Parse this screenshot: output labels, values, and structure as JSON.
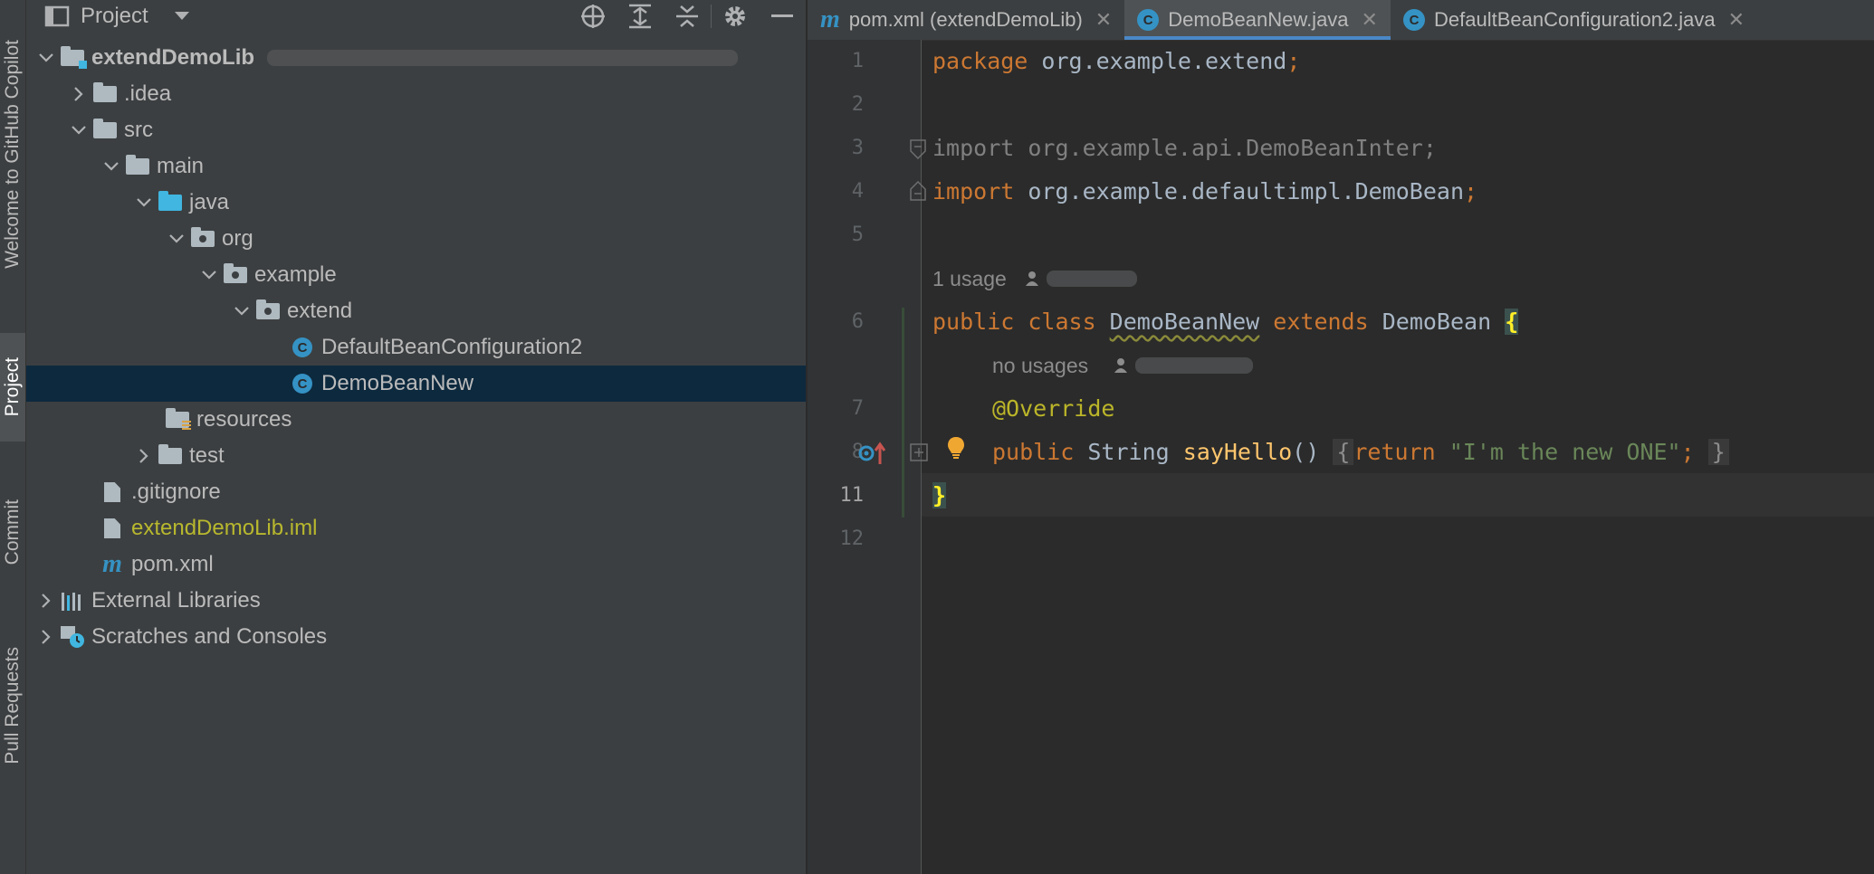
{
  "sidebar_tabs": [
    {
      "label": "Welcome to GitHub Copilot"
    },
    {
      "label": "Project"
    },
    {
      "label": "Commit"
    },
    {
      "label": "Pull Requests"
    }
  ],
  "project_panel": {
    "title": "Project",
    "tools": [
      "locate-icon",
      "expand-all-icon",
      "collapse-all-icon",
      "gear-icon",
      "minimize-icon"
    ],
    "tree": [
      {
        "label": "extendDemoLib",
        "depth": 0,
        "expanded": true,
        "icon": "module-folder-icon",
        "bold": true
      },
      {
        "label": ".idea",
        "depth": 1,
        "expanded": false,
        "icon": "folder-icon"
      },
      {
        "label": "src",
        "depth": 1,
        "expanded": true,
        "icon": "folder-icon"
      },
      {
        "label": "main",
        "depth": 2,
        "expanded": true,
        "icon": "folder-icon"
      },
      {
        "label": "java",
        "depth": 3,
        "expanded": true,
        "icon": "source-folder-icon"
      },
      {
        "label": "org",
        "depth": 4,
        "expanded": true,
        "icon": "package-icon"
      },
      {
        "label": "example",
        "depth": 5,
        "expanded": true,
        "icon": "package-icon"
      },
      {
        "label": "extend",
        "depth": 6,
        "expanded": true,
        "icon": "package-icon"
      },
      {
        "label": "DefaultBeanConfiguration2",
        "depth": 7,
        "icon": "class-icon"
      },
      {
        "label": "DemoBeanNew",
        "depth": 7,
        "icon": "class-icon",
        "selected": true
      },
      {
        "label": "resources",
        "depth": 4,
        "icon": "resources-folder-icon"
      },
      {
        "label": "test",
        "depth": 3,
        "expanded": false,
        "icon": "folder-icon"
      },
      {
        "label": ".gitignore",
        "depth": 2,
        "icon": "file-icon"
      },
      {
        "label": "extendDemoLib.iml",
        "depth": 2,
        "icon": "file-icon",
        "color": "#b8b82e"
      },
      {
        "label": "pom.xml",
        "depth": 2,
        "icon": "maven-icon"
      },
      {
        "label": "External Libraries",
        "depth": 0,
        "expanded": false,
        "icon": "libraries-icon"
      },
      {
        "label": "Scratches and Consoles",
        "depth": 0,
        "expanded": false,
        "icon": "scratches-icon"
      }
    ]
  },
  "editor": {
    "tabs": [
      {
        "label": "pom.xml (extendDemoLib)",
        "icon": "maven-icon",
        "active": false
      },
      {
        "label": "DemoBeanNew.java",
        "icon": "class-icon",
        "active": true
      },
      {
        "label": "DefaultBeanConfiguration2.java",
        "icon": "class-icon",
        "active": false
      }
    ],
    "line_numbers": [
      "1",
      "2",
      "3",
      "4",
      "5",
      "6",
      "7",
      "8",
      "11",
      "12"
    ],
    "current_line": "11",
    "code": {
      "l1_kw": "package",
      "l1_rest": " org.example.extend",
      "l1_semi": ";",
      "l3": "import org.example.api.DemoBeanInter;",
      "l4_kw": "import",
      "l4_rest": " org.example.defaultimpl.DemoBean",
      "l4_semi": ";",
      "hint1": "1 usage",
      "l6_kw1": "public class ",
      "l6_name": "DemoBeanNew",
      "l6_kw2": " extends ",
      "l6_rest": "DemoBean ",
      "l6_brace": "{",
      "hint2": "no usages",
      "l7": "@Override",
      "l8_kw": "public ",
      "l8_type": "String ",
      "l8_fn": "sayHello",
      "l8_parens": "()",
      "l8_ob": "{",
      "l8_ret": "return ",
      "l8_str": "\"I'm the new ONE\"",
      "l8_semi": ";",
      "l8_cb": "}",
      "l11": "}"
    }
  }
}
